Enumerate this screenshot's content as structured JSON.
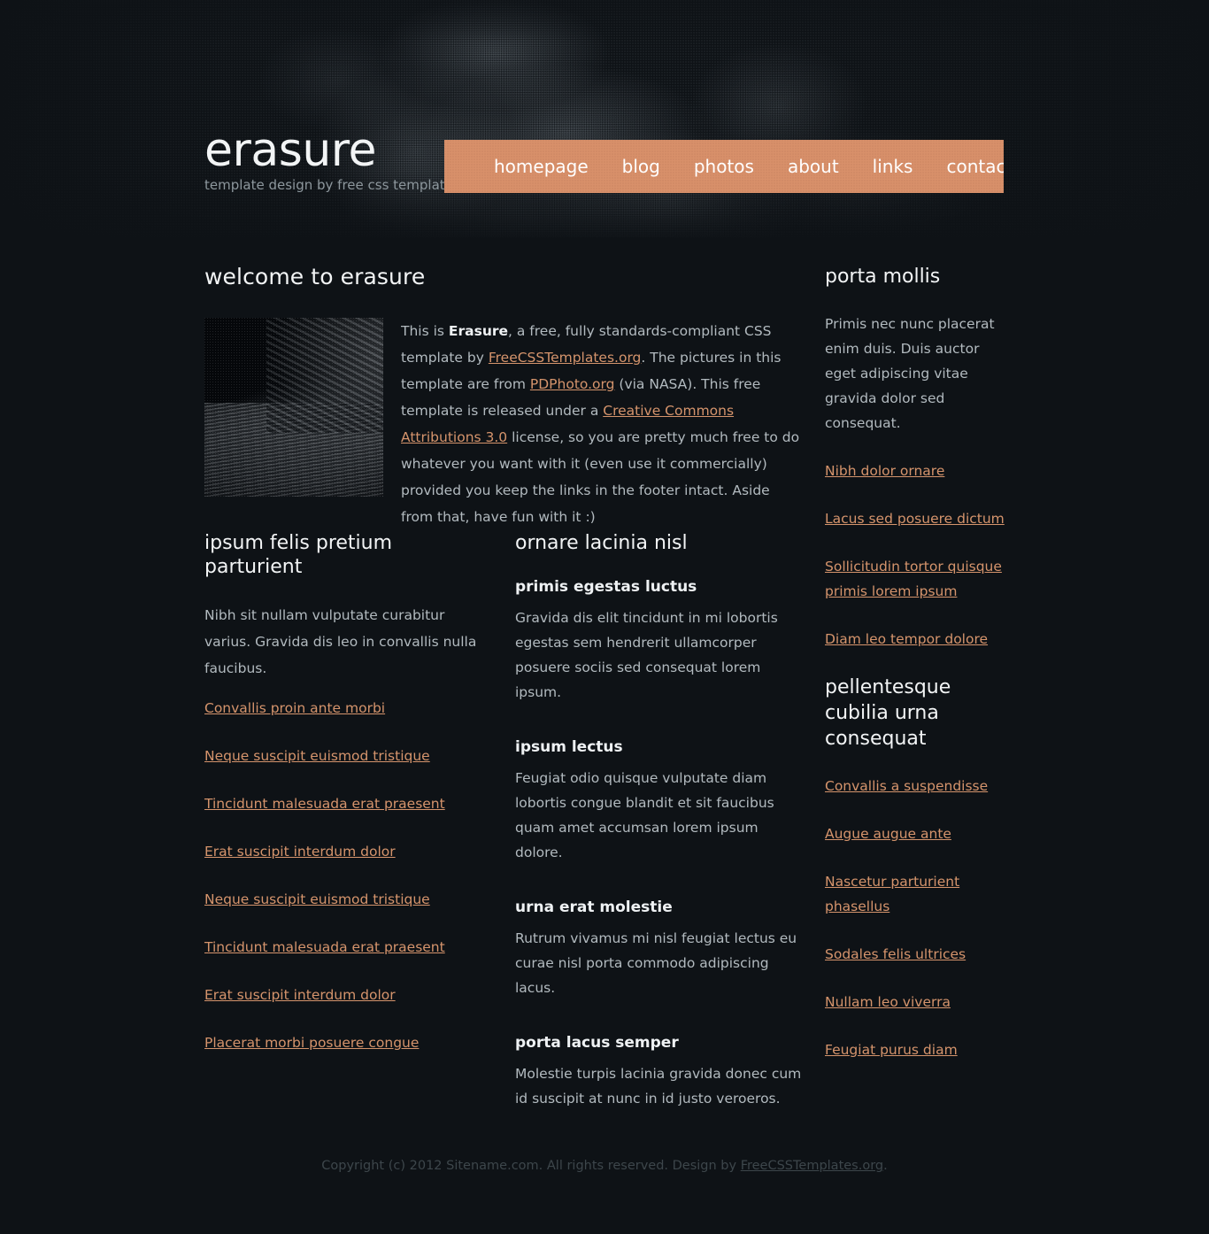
{
  "header": {
    "logo_title": "erasure",
    "tagline": "template design by free css templates",
    "nav": [
      {
        "label": "homepage"
      },
      {
        "label": "blog"
      },
      {
        "label": "photos"
      },
      {
        "label": "about"
      },
      {
        "label": "links"
      },
      {
        "label": "contact"
      }
    ]
  },
  "welcome": {
    "title": "welcome to erasure",
    "image_alt": "dithered lunar surface photo",
    "text_part1": "This is ",
    "emph": "Erasure",
    "text_part2": ", a free, fully standards-compliant CSS template by ",
    "link1": "FreeCSSTemplates.org",
    "text_part3": ". The pictures in this template are from ",
    "link2": "PDPhoto.org",
    "text_part4": " (via NASA). This free template is released under a ",
    "link3": "Creative Commons Attributions 3.0",
    "text_part5": " license, so you are pretty much free to do whatever you want with it (even use it commercially) provided you keep the links in the footer intact. Aside from that, have fun with it :)"
  },
  "col1": {
    "title": "ipsum felis pretium parturient",
    "intro": "Nibh sit nullam vulputate curabitur varius. Gravida dis leo in convallis nulla faucibus.",
    "links": [
      "Convallis proin ante morbi",
      "Neque suscipit euismod tristique",
      "Tincidunt malesuada erat praesent",
      "Erat suscipit interdum dolor",
      "Neque suscipit euismod tristique",
      "Tincidunt malesuada erat praesent",
      "Erat suscipit interdum dolor",
      "Placerat morbi posuere congue"
    ]
  },
  "col2": {
    "title": "ornare lacinia nisl",
    "blocks": [
      {
        "heading": "primis egestas luctus",
        "text": "Gravida dis elit tincidunt in mi lobortis egestas sem hendrerit ullamcorper posuere sociis sed consequat lorem ipsum."
      },
      {
        "heading": "ipsum lectus",
        "text": "Feugiat odio quisque vulputate diam lobortis congue blandit et sit faucibus quam amet accumsan lorem ipsum dolore."
      },
      {
        "heading": "urna erat molestie",
        "text": "Rutrum vivamus mi nisl feugiat lectus eu curae nisl porta commodo adipiscing lacus."
      },
      {
        "heading": "porta lacus semper",
        "text": "Molestie turpis lacinia gravida donec cum id suscipit at nunc in id justo veroeros."
      }
    ]
  },
  "sidebar": {
    "block1": {
      "title": "porta mollis",
      "paragraph": "Primis nec nunc placerat enim duis. Duis auctor eget adipiscing vitae gravida dolor sed consequat.",
      "links": [
        "Nibh dolor ornare",
        "Lacus sed posuere dictum",
        "Sollicitudin tortor quisque primis lorem ipsum",
        "Diam leo tempor dolore"
      ]
    },
    "block2": {
      "title": "pellentesque cubilia urna consequat",
      "links": [
        "Convallis a suspendisse",
        "Augue augue ante",
        "Nascetur parturient phasellus",
        "Sodales felis ultrices",
        "Nullam leo viverra",
        "Feugiat purus diam"
      ]
    }
  },
  "footer": {
    "text_before": "Copyright (c) 2012 Sitename.com. All rights reserved. Design by ",
    "link": "FreeCSSTemplates.org",
    "text_after": "."
  },
  "colors": {
    "background": "#0e1216",
    "nav_accent": "#d8906a",
    "link": "#d5946c",
    "heading": "#f2f4f5",
    "body_text": "#b2babf",
    "footer_text": "#3d464b"
  }
}
